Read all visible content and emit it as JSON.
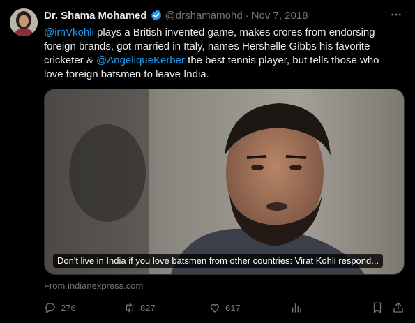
{
  "tweet": {
    "author_name": "Dr. Shama Mohamed",
    "handle": "@drshamamohd",
    "separator": "·",
    "date": "Nov 7, 2018",
    "text_parts": [
      {
        "text": "@imVkohli",
        "mention": true
      },
      {
        "text": " plays a British invented game, makes crores from endorsing foreign brands, got married in Italy, names Hershelle Gibbs his favorite cricketer & ",
        "mention": false
      },
      {
        "text": "@AngeliqueKerber",
        "mention": true
      },
      {
        "text": " the best tennis player, but tells those who love foreign batsmen to leave India.",
        "mention": false
      }
    ]
  },
  "card": {
    "caption": "Don't live in India if you love batsmen from other countries: Virat Kohli respond...",
    "source": "From indianexpress.com"
  },
  "actions": {
    "replies": "276",
    "retweets": "827",
    "likes": "617"
  },
  "icons": {
    "verified": "verified-badge-icon",
    "more": "more-options-icon",
    "reply": "reply-icon",
    "retweet": "retweet-icon",
    "like": "heart-icon",
    "views": "views-icon",
    "bookmark": "bookmark-icon",
    "share": "share-icon"
  },
  "colors": {
    "background": "#000000",
    "text": "#e7e9ea",
    "muted": "#71767b",
    "accent": "#1d9bf0"
  }
}
